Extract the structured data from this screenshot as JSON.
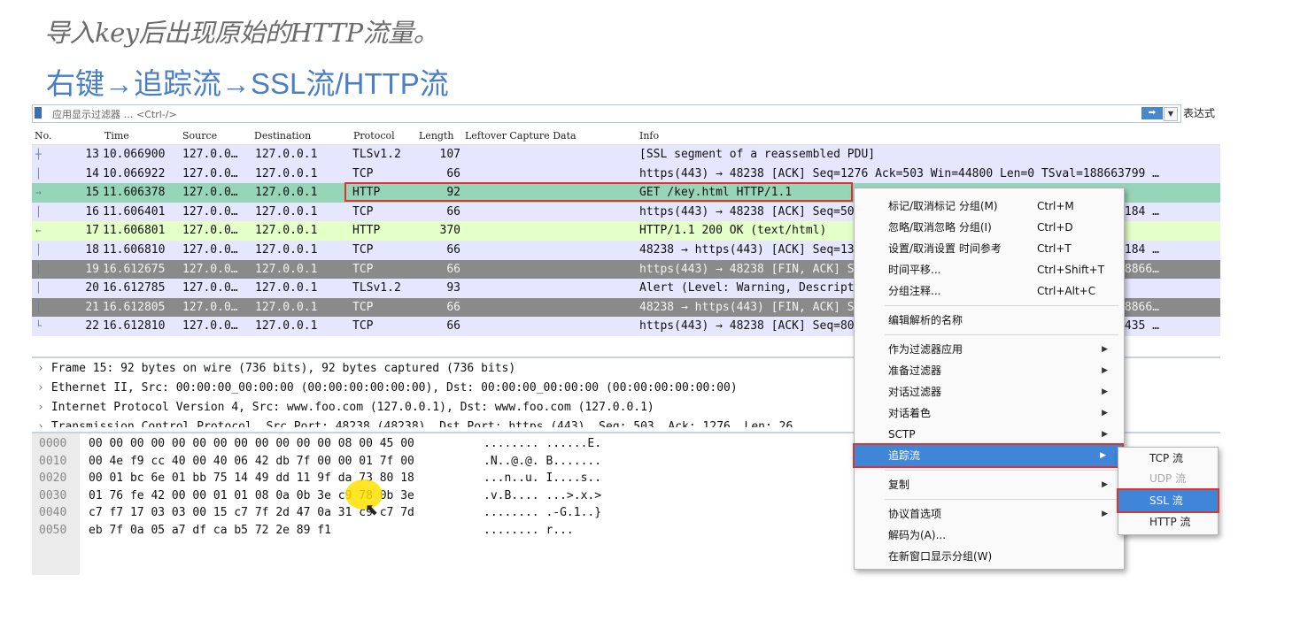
{
  "caption": {
    "line1": "导入key后出现原始的HTTP流量。",
    "line2": "右键→追踪流→SSL流/HTTP流"
  },
  "filter": {
    "placeholder": "应用显示过滤器 … <Ctrl-/>",
    "apply_icon": "arrow-right-icon",
    "dropdown_icon": "chevron-down-icon",
    "expr_label": "表达式"
  },
  "packet_list": {
    "columns": {
      "no": "No.",
      "time": "Time",
      "source": "Source",
      "destination": "Destination",
      "protocol": "Protocol",
      "length": "Length",
      "leftover": "Leftover Capture Data",
      "info": "Info"
    },
    "rows": [
      {
        "no": "13",
        "time": "10.066900",
        "src": "127.0.0…",
        "dst": "127.0.0.1",
        "proto": "TLSv1.2",
        "len": "107",
        "info": "[SSL segment of a reassembled PDU]",
        "bg": "#e7e6ff",
        "fg": "#111111"
      },
      {
        "no": "14",
        "time": "10.066922",
        "src": "127.0.0…",
        "dst": "127.0.0.1",
        "proto": "TCP",
        "len": "66",
        "info": "https(443) → 48238 [ACK] Seq=1276 Ack=503 Win=44800 Len=0 TSval=188663799 …",
        "bg": "#e7e6ff",
        "fg": "#111111"
      },
      {
        "no": "15",
        "time": "11.606378",
        "src": "127.0.0…",
        "dst": "127.0.0.1",
        "proto": "HTTP",
        "len": "92",
        "info": "GET /key.html HTTP/1.1",
        "bg": "#97d5b9",
        "fg": "#111111"
      },
      {
        "no": "16",
        "time": "11.606401",
        "src": "127.0.0…",
        "dst": "127.0.0.1",
        "proto": "TCP",
        "len": "66",
        "info": "https(443) → 48238 [ACK] Seq=503 Ack=1302 Win=44800 Len=0 TSval=188664184 …",
        "bg": "#e7e6ff",
        "fg": "#111111"
      },
      {
        "no": "17",
        "time": "11.606801",
        "src": "127.0.0…",
        "dst": "127.0.0.1",
        "proto": "HTTP",
        "len": "370",
        "info": "HTTP/1.1 200 OK  (text/html)",
        "bg": "#e4ffc7",
        "fg": "#111111"
      },
      {
        "no": "18",
        "time": "11.606810",
        "src": "127.0.0…",
        "dst": "127.0.0.1",
        "proto": "TCP",
        "len": "66",
        "info": "48238 → https(443) [ACK] Seq=1302 Ack=807 Win=44800 Len=0 TSval=188664184 …",
        "bg": "#e7e6ff",
        "fg": "#111111"
      },
      {
        "no": "19",
        "time": "16.612675",
        "src": "127.0.0…",
        "dst": "127.0.0.1",
        "proto": "TCP",
        "len": "66",
        "info": "https(443) → 48238 [FIN, ACK] Seq=807 Ack=1302 Win=44800 Len=0 TSval=18866…",
        "bg": "#8a8a8a",
        "fg": "#f2f2f2"
      },
      {
        "no": "20",
        "time": "16.612785",
        "src": "127.0.0…",
        "dst": "127.0.0.1",
        "proto": "TLSv1.2",
        "len": "93",
        "info": "Alert (Level: Warning, Description: Close Notify)",
        "bg": "#e7e6ff",
        "fg": "#111111"
      },
      {
        "no": "21",
        "time": "16.612805",
        "src": "127.0.0…",
        "dst": "127.0.0.1",
        "proto": "TCP",
        "len": "66",
        "info": "48238 → https(443) [FIN, ACK] Seq=1329 Ack=808 Win=44800 Len=0 TSval=18866…",
        "bg": "#8a8a8a",
        "fg": "#f2f2f2"
      },
      {
        "no": "22",
        "time": "16.612810",
        "src": "127.0.0…",
        "dst": "127.0.0.1",
        "proto": "TCP",
        "len": "66",
        "info": "https(443) → 48238 [ACK] Seq=808 Ack=1330 Win=44800 Len=0 TSval=188665435 …",
        "bg": "#e7e6ff",
        "fg": "#111111"
      }
    ]
  },
  "details": [
    "Frame 15: 92 bytes on wire (736 bits), 92 bytes captured (736 bits)",
    "Ethernet II, Src: 00:00:00_00:00:00 (00:00:00:00:00:00), Dst: 00:00:00_00:00:00 (00:00:00:00:00:00)",
    "Internet Protocol Version 4, Src: www.foo.com (127.0.0.1), Dst: www.foo.com (127.0.0.1)",
    "Transmission Control Protocol, Src Port: 48238 (48238), Dst Port: https (443), Seq: 503, Ack: 1276, Len: 26"
  ],
  "bytes": [
    {
      "off": "0000",
      "hex": "00 00 00 00 00 00 00 00  00 00 00 00 08 00 45 00",
      "ascii": "........ ......E."
    },
    {
      "off": "0010",
      "hex": "00 4e f9 cc 40 00 40 06  42 db 7f 00 00 01 7f 00",
      "ascii": ".N..@.@. B......."
    },
    {
      "off": "0020",
      "hex": "00 01 bc 6e 01 bb 75 14  49 dd 11 9f da 73 80 18",
      "ascii": "...n..u. I....s.."
    },
    {
      "off": "0030",
      "hex": "01 76 fe 42 00 00 01 01  08 0a 0b 3e c9 78 0b 3e",
      "ascii": ".v.B.... ...>.x.>"
    },
    {
      "off": "0040",
      "hex": "c7 f7 17 03 03 00 15 c7  7f 2d 47 0a 31 c9 c7 7d",
      "ascii": "........ .-G.1..}"
    },
    {
      "off": "0050",
      "hex": "eb 7f 0a 05 a7 df ca b5  72 2e 89 f1",
      "ascii": "........ r..."
    }
  ],
  "context_menu": {
    "items": [
      {
        "label": "标记/取消标记 分组(M)",
        "shortcut": "Ctrl+M"
      },
      {
        "label": "忽略/取消忽略 分组(I)",
        "shortcut": "Ctrl+D"
      },
      {
        "label": "设置/取消设置 时间参考",
        "shortcut": "Ctrl+T"
      },
      {
        "label": "时间平移...",
        "shortcut": "Ctrl+Shift+T"
      },
      {
        "label": "分组注释...",
        "shortcut": "Ctrl+Alt+C"
      },
      {
        "label": "编辑解析的名称",
        "shortcut": ""
      },
      {
        "label": "作为过滤器应用",
        "shortcut": ""
      },
      {
        "label": "准备过滤器",
        "shortcut": ""
      },
      {
        "label": "对话过滤器",
        "shortcut": ""
      },
      {
        "label": "对话着色",
        "shortcut": ""
      },
      {
        "label": "SCTP",
        "shortcut": ""
      },
      {
        "label": "追踪流",
        "shortcut": ""
      },
      {
        "label": "复制",
        "shortcut": ""
      },
      {
        "label": "协议首选项",
        "shortcut": ""
      },
      {
        "label": "解码为(A)...",
        "shortcut": ""
      },
      {
        "label": "在新窗口显示分组(W)",
        "shortcut": ""
      }
    ],
    "submenu_arrow_icon": "triangle-right-icon"
  },
  "follow_submenu": {
    "items": [
      {
        "label": "TCP 流"
      },
      {
        "label": "UDP 流"
      },
      {
        "label": "SSL 流"
      },
      {
        "label": "HTTP 流"
      }
    ]
  },
  "colors": {
    "accent_red": "#e0332f",
    "menu_highlight": "#3f86d8",
    "http_green": "#97d5b9",
    "tcp_lavender": "#e7e6ff",
    "fin_gray": "#8a8a8a"
  }
}
